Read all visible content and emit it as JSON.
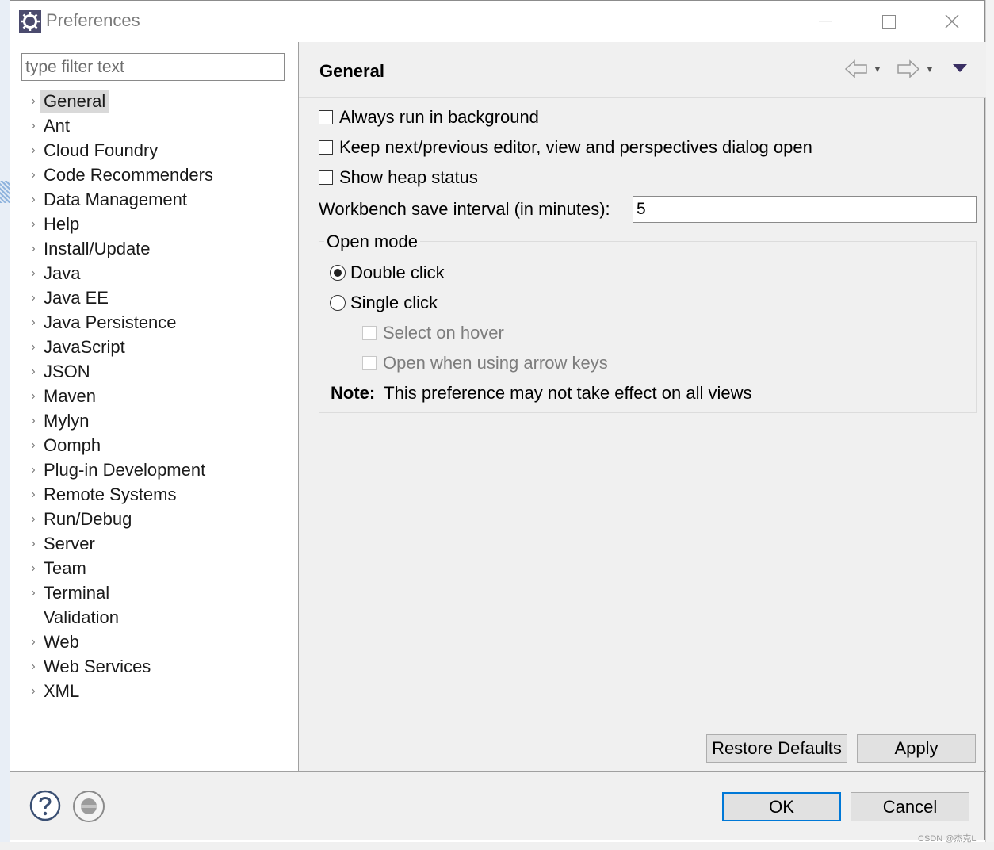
{
  "window": {
    "title": "Preferences"
  },
  "filter": {
    "placeholder": "type filter text"
  },
  "tree": {
    "items": [
      {
        "label": "General",
        "expandable": true,
        "selected": true
      },
      {
        "label": "Ant",
        "expandable": true
      },
      {
        "label": "Cloud Foundry",
        "expandable": true
      },
      {
        "label": "Code Recommenders",
        "expandable": true
      },
      {
        "label": "Data Management",
        "expandable": true
      },
      {
        "label": "Help",
        "expandable": true
      },
      {
        "label": "Install/Update",
        "expandable": true
      },
      {
        "label": "Java",
        "expandable": true
      },
      {
        "label": "Java EE",
        "expandable": true
      },
      {
        "label": "Java Persistence",
        "expandable": true
      },
      {
        "label": "JavaScript",
        "expandable": true
      },
      {
        "label": "JSON",
        "expandable": true
      },
      {
        "label": "Maven",
        "expandable": true
      },
      {
        "label": "Mylyn",
        "expandable": true
      },
      {
        "label": "Oomph",
        "expandable": true
      },
      {
        "label": "Plug-in Development",
        "expandable": true
      },
      {
        "label": "Remote Systems",
        "expandable": true
      },
      {
        "label": "Run/Debug",
        "expandable": true
      },
      {
        "label": "Server",
        "expandable": true
      },
      {
        "label": "Team",
        "expandable": true
      },
      {
        "label": "Terminal",
        "expandable": true
      },
      {
        "label": "Validation",
        "expandable": false
      },
      {
        "label": "Web",
        "expandable": true
      },
      {
        "label": "Web Services",
        "expandable": true
      },
      {
        "label": "XML",
        "expandable": true
      }
    ]
  },
  "page": {
    "title": "General",
    "always_run_background": "Always run in background",
    "keep_dialog_open": "Keep next/previous editor, view and perspectives dialog open",
    "show_heap_status": "Show heap status",
    "save_interval_label": "Workbench save interval (in minutes):",
    "save_interval_value": "5",
    "open_mode": {
      "legend": "Open mode",
      "double_click": "Double click",
      "single_click": "Single click",
      "select_on_hover": "Select on hover",
      "open_arrow_keys": "Open when using arrow keys",
      "selected": "double_click"
    },
    "note_label": "Note:",
    "note_text": "This preference may not take effect on all views"
  },
  "buttons": {
    "restore_defaults": "Restore Defaults",
    "apply": "Apply",
    "ok": "OK",
    "cancel": "Cancel"
  },
  "watermark": "CSDN @杰克L",
  "colors": {
    "default_button_border": "#0078d7",
    "selection": "#d9d9d9"
  }
}
